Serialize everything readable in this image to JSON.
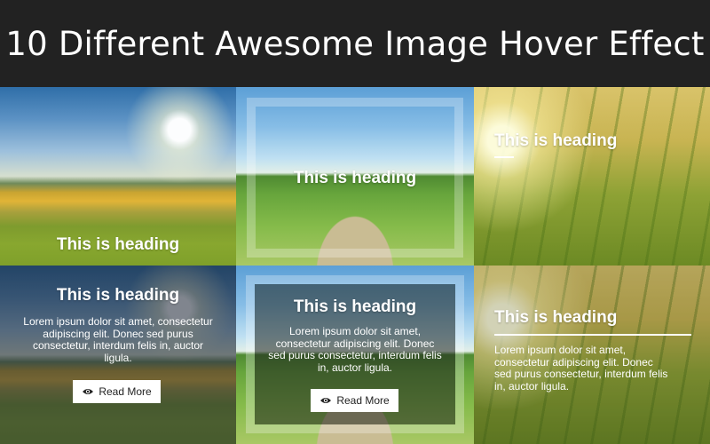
{
  "header": {
    "title": "10 Different Awesome Image Hover Effect"
  },
  "tiles": [
    {
      "heading": "This is heading",
      "scene": "sunset-field"
    },
    {
      "heading": "This is heading",
      "scene": "country-road"
    },
    {
      "heading": "This is heading",
      "scene": "wheat-field"
    },
    {
      "heading": "This is heading",
      "scene": "sunset-field",
      "body_lines": [
        "Lorem ipsum dolor sit amet, consectetur",
        "adipiscing elit. Donec sed purus",
        "consectetur, interdum felis in, auctor",
        "ligula."
      ],
      "button_label": "Read More",
      "button_icon": "eye-icon"
    },
    {
      "heading": "This is heading",
      "scene": "country-road",
      "body_lines": [
        "Lorem ipsum dolor sit amet,",
        "consectetur adipiscing elit. Donec",
        "sed purus consectetur, interdum felis",
        "in, auctor ligula."
      ],
      "button_label": "Read More",
      "button_icon": "eye-icon"
    },
    {
      "heading": "This is heading",
      "scene": "wheat-field",
      "body_lines": [
        "Lorem ipsum dolor sit amet,",
        "consectetur adipiscing elit. Donec",
        "sed purus consectetur, interdum felis",
        "in, auctor ligula."
      ]
    }
  ],
  "colors": {
    "header_bg": "#222222",
    "text": "#ffffff",
    "button_bg": "#ffffff"
  }
}
